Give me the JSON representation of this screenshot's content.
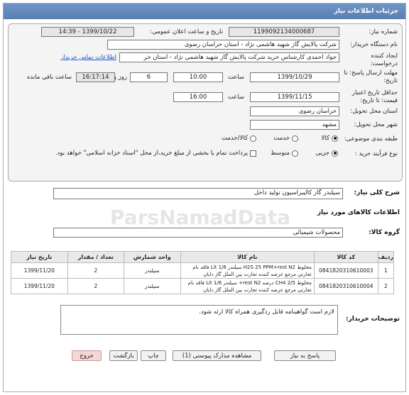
{
  "header": {
    "title": "جزئیات اطلاعات نیاز"
  },
  "form": {
    "need_number_label": "شماره نیاز:",
    "need_number": "1199092134000687",
    "announce_label": "تاریخ و ساعت اعلان عمومی:",
    "announce_value": "1399/10/22 - 14:39",
    "buyer_label": "نام دستگاه خریدار:",
    "buyer_value": "شرکت پالایش گاز شهید هاشمی نژاد - استان خراسان رضوی",
    "creator_label": "ایجاد کننده درخواست:",
    "creator_value": "جواد احمدی کارشناس خرید شرکت پالایش گاز شهید هاشمی نژاد - استان خر",
    "contact_link": "اطلاعات تماس خریدار",
    "deadline_label": "مهلت ارسال پاسخ: تا تاریخ:",
    "deadline_date": "1399/10/29",
    "time_label": "ساعت",
    "deadline_time": "10:00",
    "days_value": "6",
    "days_label": "روز و",
    "remaining_time": "16:17:14",
    "remaining_label": "ساعت باقی مانده",
    "validity_label": "حداقل تاریخ اعتبار قیمت: تا تاریخ:",
    "validity_date": "1399/11/15",
    "validity_time_label": "ساعت",
    "validity_time": "16:00",
    "province_label": "استان محل تحویل:",
    "province_value": "خراسان رضوی",
    "city_label": "شهر محل تحویل:",
    "city_value": "مشهد",
    "category_label": "طبقه بندی موضوعی:",
    "category_options": [
      "کالا",
      "خدمت",
      "کالا/خدمت"
    ],
    "process_label": "نوع فرآیند خرید :",
    "process_options": [
      "جزیی",
      "متوسط"
    ],
    "payment_note": "پرداخت تمام یا بخشی از مبلغ خرید،از محل \"اسناد خزانه اسلامی\" خواهد بود."
  },
  "summary": {
    "label": "شرح کلی نیاز:",
    "value": "سیلندر گاز کالیبراسیون تولید داخل"
  },
  "goods_section": "اطلاعات کالاهای مورد نیاز",
  "group": {
    "label": "گروه کالا:",
    "value": "محصولات شیمیائی"
  },
  "table": {
    "headers": [
      "ردیف",
      "کد کالا",
      "نام کالا",
      "واحد شمارش",
      "تعداد / مقدار",
      "تاریخ نیاز"
    ],
    "rows": [
      {
        "row": "1",
        "code": "0841820310610003",
        "name_line1": "مخلوط H2S 25 PPM+rest N2 سیلندر Lit 1/6 فاقد نام",
        "name_line2": "تجارتی مرجع عرضه کننده تجارت بین الملل گاز دایان",
        "unit": "سیلندر",
        "qty": "2",
        "date": "1399/11/20"
      },
      {
        "row": "2",
        "code": "0841820310610004",
        "name_line1": "مخلوط CH4 2/5 درصد rest N2+ سیلندر Lit 1/6 فاقد نام",
        "name_line2": "تجارتی مرجع عرضه کننده تجارت بین الملل گاز دایان",
        "unit": "سیلندر",
        "qty": "2",
        "date": "1399/11/20"
      }
    ]
  },
  "notes": {
    "label": "توضیحات خریدار:",
    "value": "لازم است گواهینامه قابل ردگیری همراه کالا ارئه شود."
  },
  "buttons": {
    "reply": "پاسخ به نیاز",
    "docs": "مشاهده مدارک پیوستی (1)",
    "print": "چاپ",
    "back": "بازگشت",
    "exit": "خروج"
  },
  "watermark": "ParsNamadData"
}
